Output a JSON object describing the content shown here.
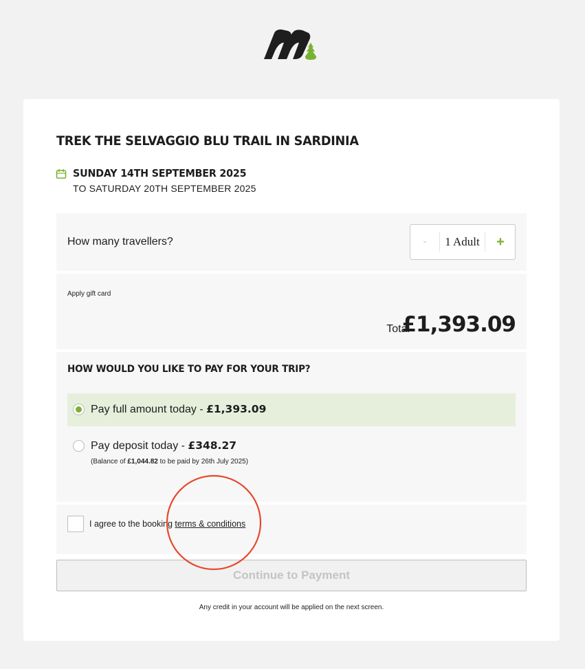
{
  "brand": {
    "logo": "brand-logo",
    "accent_color": "#7ab230"
  },
  "trip": {
    "title": "TREK THE SELVAGGIO BLU TRAIL IN SARDINIA",
    "date_start": "SUNDAY 14TH SEPTEMBER 2025",
    "date_end": "TO SATURDAY 20TH SEPTEMBER 2025",
    "date_icon": "calendar-icon"
  },
  "travellers": {
    "label": "How many travellers?",
    "value": "1 Adult",
    "minus": "-",
    "plus": "+"
  },
  "pricing": {
    "gift_card_label": "Apply gift card",
    "total_label": "Total",
    "total_value": "£1,393.09"
  },
  "payment": {
    "heading": "HOW WOULD YOU LIKE TO PAY FOR YOUR TRIP?",
    "full": {
      "label": "Pay full amount today - ",
      "amount": "£1,393.09",
      "selected": true
    },
    "deposit": {
      "label": "Pay deposit today - ",
      "amount": "£348.27",
      "balance_prefix": "(Balance of ",
      "balance_amount": "£1,044.82",
      "balance_suffix": " to be paid by 26th July 2025)",
      "selected": false
    }
  },
  "terms": {
    "prefix": "I agree to the booking ",
    "link": "terms & conditions",
    "checked": false
  },
  "continue_label": "Continue to Payment",
  "credit_note": "Any credit in your account will be applied on the next screen.",
  "annotation": {
    "color": "#e8472b"
  }
}
